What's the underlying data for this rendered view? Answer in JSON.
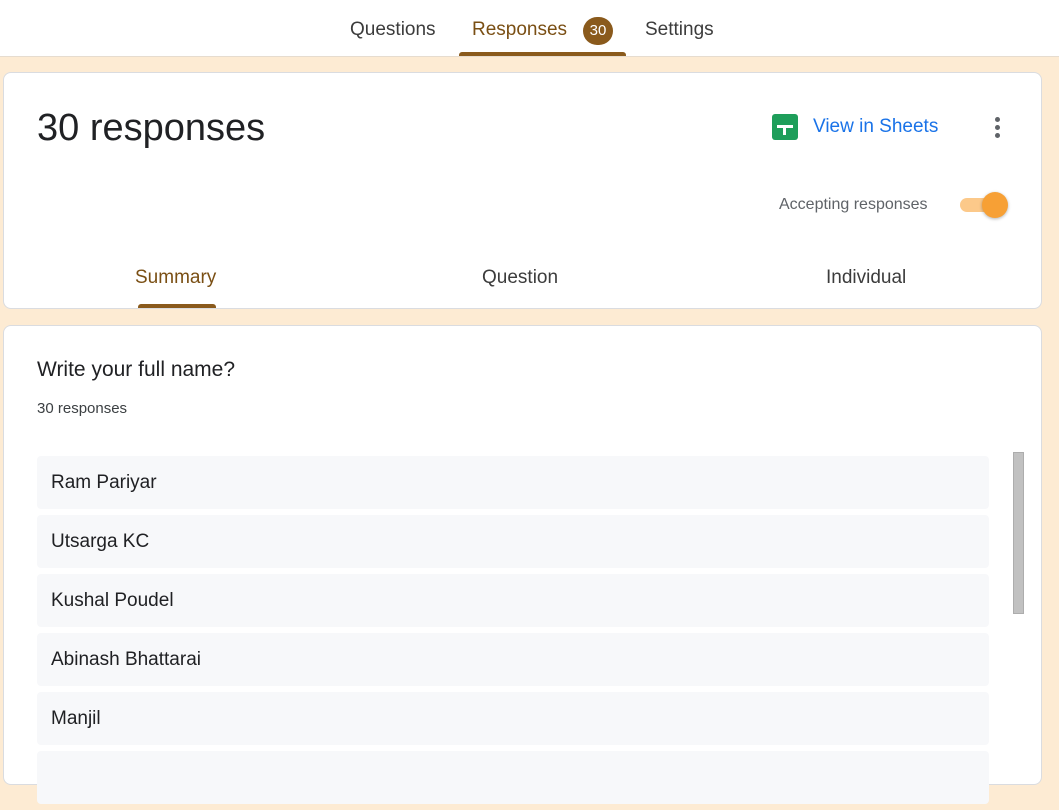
{
  "top_tabs": {
    "questions": "Questions",
    "responses": "Responses",
    "responses_count": "30",
    "settings": "Settings"
  },
  "summary_card": {
    "title": "30 responses",
    "view_in_sheets": "View in Sheets",
    "accepting_label": "Accepting responses",
    "accepting_on": true
  },
  "sub_tabs": {
    "summary": "Summary",
    "question": "Question",
    "individual": "Individual",
    "active": "summary"
  },
  "question": {
    "title": "Write your full name?",
    "count": "30 responses",
    "answers": [
      "Ram Pariyar",
      "Utsarga KC",
      "Kushal Poudel",
      "Abinash Bhattarai",
      "Manjil"
    ]
  },
  "icons": {
    "sheets": "google-sheets-icon",
    "more": "more-vert-icon"
  },
  "colors": {
    "accent": "#8a5a1c",
    "link": "#1a73e8",
    "background": "#fdebd3",
    "toggle_on": "#f7a035",
    "sheets_green": "#1e9e5a"
  }
}
